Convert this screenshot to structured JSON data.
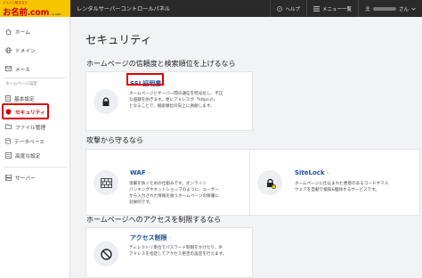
{
  "header": {
    "logo_tagline": "ドメイン取るなら",
    "logo_brand": "お名前.com",
    "logo_sub": "by GMO",
    "app_title": "レンタルサーバーコントロールパネル",
    "help_label": "ヘルプ",
    "menu_label": "メニュー一覧",
    "user_suffix": "さん"
  },
  "sidebar": {
    "home": "ホーム",
    "domain": "ドメイン",
    "mail": "メール",
    "section_label": "ホームページ設定",
    "basic": "基本設定",
    "security": "セキュリティ",
    "file": "ファイル管理",
    "database": "データベース",
    "advanced": "高度な設定",
    "server": "サーバー"
  },
  "main": {
    "title": "セキュリティ",
    "section1": "ホームページの信頼度と検索順位を上げるなら",
    "ssl": {
      "title": "SSL証明書",
      "chevron": "›",
      "desc": [
        "ホームページとサーバー間の通信を暗号化し、不正",
        "な盗聴を防ぎます。更にアドレスが「https://」",
        "となることで、検索順位の向上に貢献します。"
      ]
    },
    "section2": "攻撃から守るなら",
    "waf": {
      "title": "WAF",
      "chevron": "›",
      "desc": [
        "攻撃を防ぐための仕組みです。オンライン",
        "バンキングやネットショップのように、ユーザー",
        "から入力された情報を扱うホームページの保護に",
        "効果的です。"
      ]
    },
    "sitelock": {
      "title": "SiteLock",
      "chevron": "›",
      "desc": [
        "ホームページに仕込まれた悪意のあるコードやマル",
        "ウェアを自動で検知&駆除するサービスです。"
      ]
    },
    "section3": "ホームページへのアクセスを制限するなら",
    "access": {
      "title": "アクセス制限",
      "chevron": "›",
      "desc": [
        "ディレクトリ単位でパスワード制限をかけたり、IP",
        "アドレスを指定してアクセス拒否の設定を行えます。"
      ]
    }
  },
  "colors": {
    "accent": "#e00000",
    "link": "#1a4f9c",
    "header_bg": "#2a2a2a",
    "logo_bg": "#f6c500"
  }
}
